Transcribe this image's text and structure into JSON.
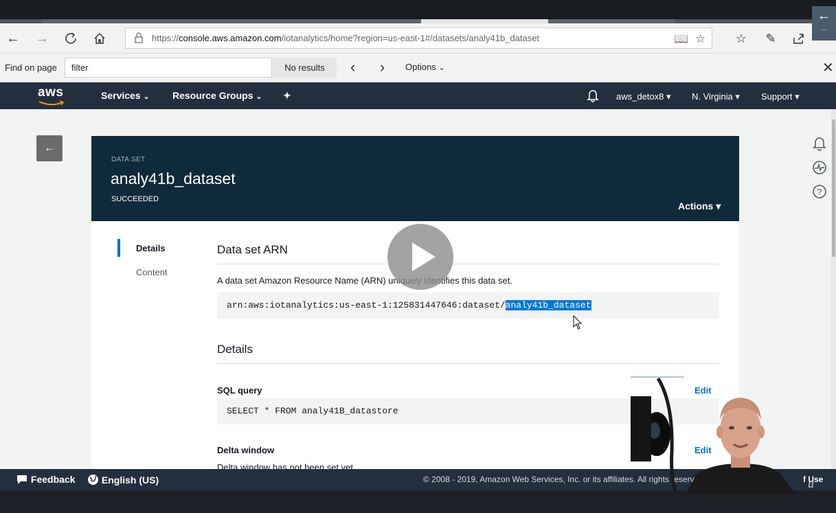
{
  "browser": {
    "url_prefix": "https://",
    "url_domain": "console.aws.amazon.com",
    "url_path": "/iotanalytics/home?region=us-east-1#/datasets/analy41b_dataset",
    "find_label": "Find on page",
    "find_query": "filter",
    "find_results": "No results",
    "find_options": "Options"
  },
  "aws_nav": {
    "logo": "aws",
    "services": "Services",
    "resource_groups": "Resource Groups",
    "account": "aws_detox8",
    "region": "N. Virginia",
    "support": "Support"
  },
  "dataset": {
    "kicker": "DATA SET",
    "name": "analy41b_dataset",
    "status": "SUCCEEDED",
    "actions_label": "Actions"
  },
  "sidebar": {
    "items": [
      {
        "label": "Details",
        "active": true
      },
      {
        "label": "Content",
        "active": false
      }
    ]
  },
  "arn_section": {
    "title": "Data set ARN",
    "description": "A data set Amazon Resource Name (ARN) uniquely identifies this data set.",
    "arn_prefix": "arn:aws:iotanalytics:us-east-1:125831447646:dataset/",
    "arn_selected": "analy41b_dataset"
  },
  "details_section": {
    "title": "Details",
    "sql_label": "SQL query",
    "sql_value": "SELECT * FROM analy41B_datastore",
    "edit_label": "Edit",
    "delta_label": "Delta window",
    "delta_text": "Delta window has not been set yet."
  },
  "footer": {
    "feedback": "Feedback",
    "language": "English (US)",
    "copyright": "© 2008 - 2019, Amazon Web Services, Inc. or its affiliates. All rights reserv",
    "terms": "f Use"
  },
  "colors": {
    "aws_dark": "#232f3e",
    "header_panel": "#0f2a3a",
    "accent_blue": "#0073bb",
    "aws_orange": "#ff9900",
    "selection": "#0078d7"
  }
}
